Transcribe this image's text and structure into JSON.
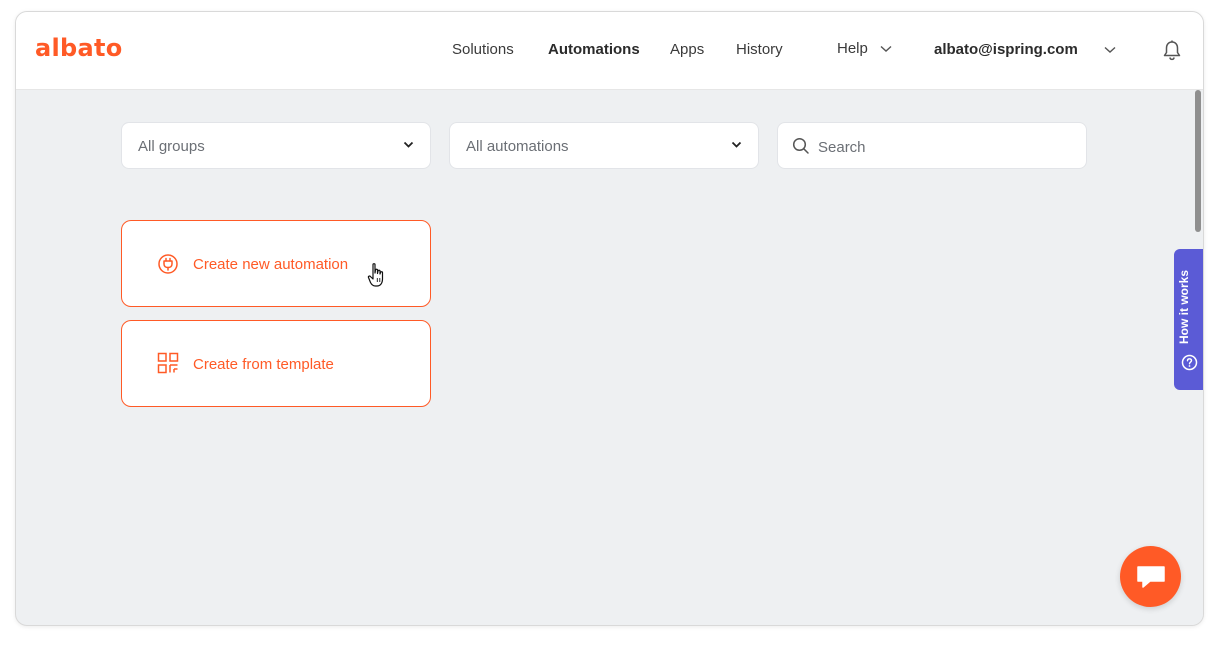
{
  "brand": {
    "logo_text": "albato",
    "accent_color": "#ff5a26"
  },
  "nav": {
    "items": [
      {
        "label": "Solutions",
        "active": false
      },
      {
        "label": "Automations",
        "active": true
      },
      {
        "label": "Apps",
        "active": false
      },
      {
        "label": "History",
        "active": false
      },
      {
        "label": "Help",
        "active": false
      }
    ],
    "account_email": "albato@ispring.com",
    "notification_icon": "bell-icon"
  },
  "filters": {
    "groups": {
      "selected": "All groups"
    },
    "automations": {
      "selected": "All automations"
    },
    "search": {
      "placeholder": "Search",
      "value": ""
    }
  },
  "actions": {
    "create_new": {
      "label": "Create new automation",
      "icon": "plug-icon"
    },
    "from_template": {
      "label": "Create from template",
      "icon": "template-icon"
    }
  },
  "side_tab": {
    "label": "How it works",
    "icon": "question-circle-icon",
    "color": "#5b5bd6"
  },
  "chat": {
    "icon": "chat-bubble-icon"
  }
}
